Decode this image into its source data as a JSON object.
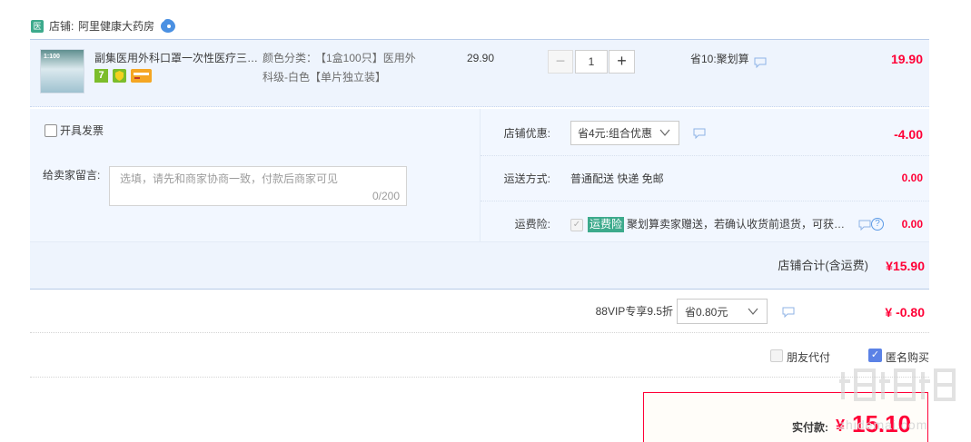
{
  "shop": {
    "badge": "医",
    "prefix": "店铺:",
    "name": "阿里健康大药房"
  },
  "item": {
    "thumb_text": "1:100",
    "title": "副集医用外科口罩一次性医疗三层灭菌独立包装",
    "badge7": "7",
    "sku_label": "颜色分类：",
    "sku_value_line1": "【1盒100只】医用外",
    "sku_value_line2": "科级-白色【单片独立装】",
    "unit_price": "29.90",
    "qty_minus": "−",
    "qty_value": "1",
    "qty_plus": "+",
    "save_text": "省10:聚划算",
    "total": "19.90"
  },
  "invoice": {
    "label": "开具发票",
    "checked": false
  },
  "message": {
    "label": "给卖家留言:",
    "placeholder": "选填，请先和商家协商一致，付款后商家可见",
    "count": "0/200"
  },
  "shop_promo": {
    "label": "店铺优惠:",
    "selected": "省4元:组合优惠",
    "amount": "-4.00"
  },
  "shipping": {
    "label": "运送方式:",
    "value": "普通配送 快递 免邮",
    "amount": "0.00"
  },
  "insurance": {
    "label": "运费险:",
    "check": "✓",
    "tag": "运费险",
    "desc": "聚划算卖家赠送，若确认收货前退货，可获得保险赔付",
    "help": "?",
    "amount": "0.00"
  },
  "shop_total": {
    "label": "店铺合计(含运费)",
    "amount": "¥15.90"
  },
  "vip": {
    "label": "88VIP专享9.5折",
    "selected": "省0.80元",
    "amount": "¥ -0.80"
  },
  "options": {
    "friend_pay": "朋友代付",
    "friend_pay_checked": false,
    "anonymous": "匿名购买",
    "anonymous_checked": true,
    "anonymous_check": "✓"
  },
  "payment": {
    "label": "实付款:",
    "currency": "¥",
    "amount": "15.10"
  },
  "watermark": {
    "text": "zhidemai.com"
  },
  "colors": {
    "accent_red": "#ff0036",
    "row_blue": "#eef4fd",
    "tag_green": "#3daa8c",
    "check_blue": "#5b82e6"
  }
}
